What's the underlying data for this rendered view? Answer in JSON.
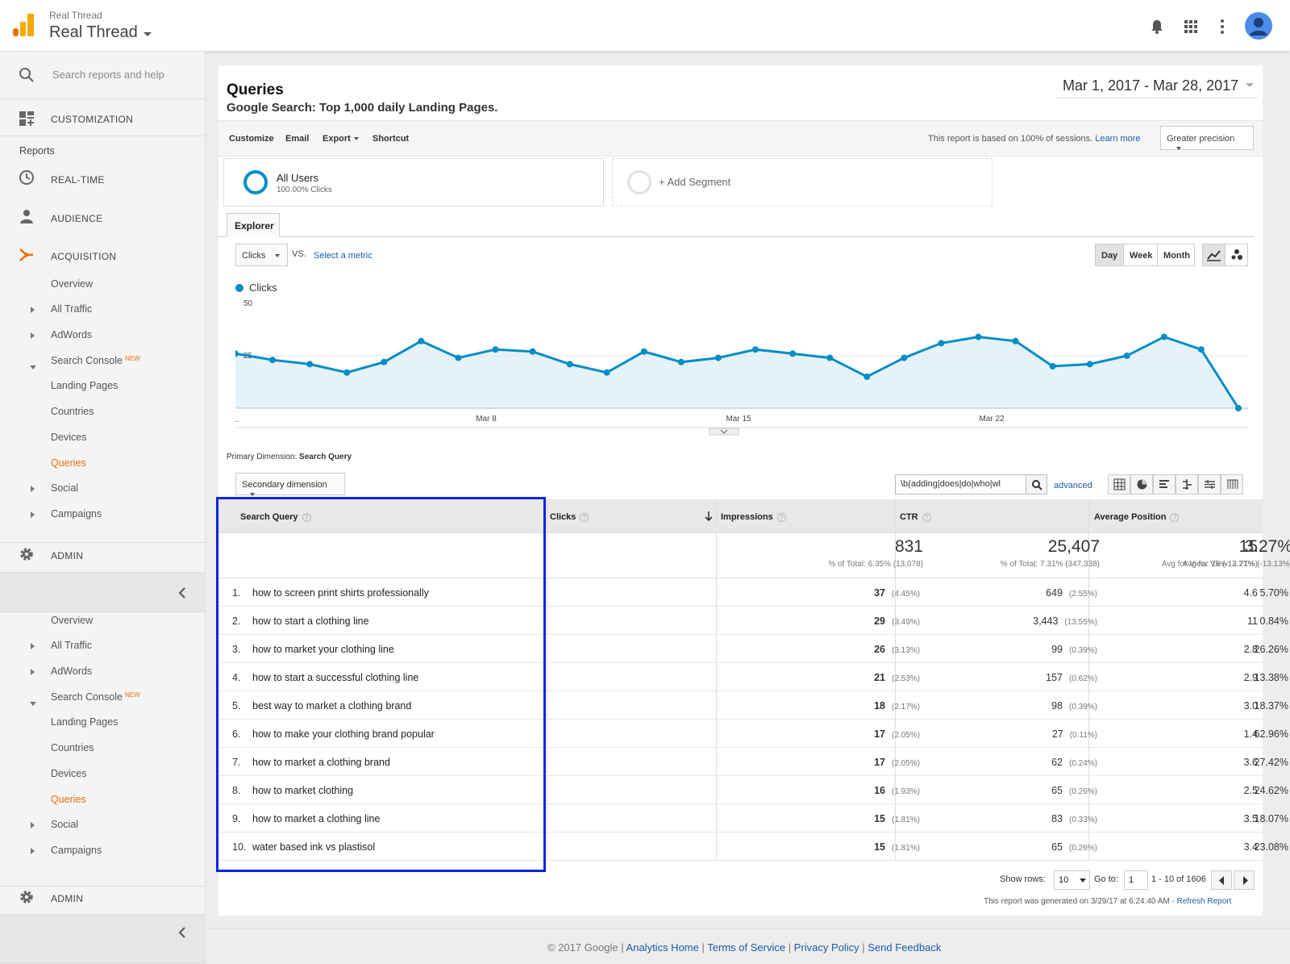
{
  "header": {
    "account_small": "Real Thread",
    "account_name": "Real Thread"
  },
  "sidebar": {
    "search_placeholder": "Search reports and help",
    "customization": "CUSTOMIZATION",
    "reports_label": "Reports",
    "realtime": "REAL-TIME",
    "audience": "AUDIENCE",
    "acquisition": "ACQUISITION",
    "admin": "ADMIN",
    "new_badge": "NEW",
    "items": [
      "Overview",
      "All Traffic",
      "AdWords",
      "Search Console",
      "Landing Pages",
      "Countries",
      "Devices",
      "Queries",
      "Social",
      "Campaigns"
    ]
  },
  "report": {
    "title": "Queries",
    "subtitle": "Google Search: Top 1,000 daily Landing Pages.",
    "date_range": "Mar 1, 2017 - Mar 28, 2017"
  },
  "toolbar": {
    "customize": "Customize",
    "email": "Email",
    "export": "Export",
    "shortcut": "Shortcut",
    "sampling": "This report is based on 100% of sessions.",
    "learn_more": "Learn more",
    "precision": "Greater precision"
  },
  "segments": {
    "name": "All Users",
    "sub": "100.00% Clicks",
    "add": "+ Add Segment"
  },
  "explorer": {
    "tab": "Explorer",
    "metric": "Clicks",
    "vs": "VS.",
    "select_metric": "Select a metric",
    "day": "Day",
    "week": "Week",
    "month": "Month"
  },
  "chart_data": {
    "type": "line",
    "title": "",
    "series": [
      {
        "name": "Clicks",
        "values": [
          26,
          23,
          21,
          17,
          22,
          32,
          24,
          28,
          27,
          21,
          17,
          27,
          22,
          24,
          28,
          26,
          24,
          15,
          24,
          31,
          34,
          32,
          20,
          21,
          25,
          34,
          28,
          0
        ]
      }
    ],
    "x_ticks": [
      "...",
      "Mar 8",
      "Mar 15",
      "Mar 22"
    ],
    "y_ticks": [
      "50",
      "25"
    ],
    "ylim": [
      0,
      50
    ],
    "color": "#058dc7",
    "grid": true
  },
  "dimensions": {
    "primary_label": "Primary Dimension:",
    "primary_value": "Search Query",
    "secondary": "Secondary dimension",
    "filter_value": "\\b(adding|does|do|who|wl",
    "advanced": "advanced"
  },
  "table": {
    "headers": {
      "query": "Search Query",
      "clicks": "Clicks",
      "impressions": "Impressions",
      "ctr": "CTR",
      "position": "Average Position"
    },
    "totals": {
      "clicks": "831",
      "clicks_sub": "% of Total: 6.35% (13,078)",
      "impressions": "25,407",
      "impressions_sub": "% of Total: 7.31% (347,338)",
      "ctr": "3.27%",
      "ctr_sub": "Avg for View: 3.77% (-13.13%)",
      "position": "15",
      "position_sub": "Avg for View: 18 (-12.21%)"
    },
    "rows": [
      {
        "idx": "1.",
        "query": "how to screen print shirts professionally",
        "clicks": "37",
        "clicks_pct": "(4.45%)",
        "impr": "649",
        "impr_pct": "(2.55%)",
        "ctr": "5.70%",
        "pos": "4.6"
      },
      {
        "idx": "2.",
        "query": "how to start a clothing line",
        "clicks": "29",
        "clicks_pct": "(3.49%)",
        "impr": "3,443",
        "impr_pct": "(13.55%)",
        "ctr": "0.84%",
        "pos": "11"
      },
      {
        "idx": "3.",
        "query": "how to market your clothing line",
        "clicks": "26",
        "clicks_pct": "(3.13%)",
        "impr": "99",
        "impr_pct": "(0.39%)",
        "ctr": "26.26%",
        "pos": "2.8"
      },
      {
        "idx": "4.",
        "query": "how to start a successful clothing line",
        "clicks": "21",
        "clicks_pct": "(2.53%)",
        "impr": "157",
        "impr_pct": "(0.62%)",
        "ctr": "13.38%",
        "pos": "2.9"
      },
      {
        "idx": "5.",
        "query": "best way to market a clothing brand",
        "clicks": "18",
        "clicks_pct": "(2.17%)",
        "impr": "98",
        "impr_pct": "(0.39%)",
        "ctr": "18.37%",
        "pos": "3.0"
      },
      {
        "idx": "6.",
        "query": "how to make your clothing brand popular",
        "clicks": "17",
        "clicks_pct": "(2.05%)",
        "impr": "27",
        "impr_pct": "(0.11%)",
        "ctr": "62.96%",
        "pos": "1.4"
      },
      {
        "idx": "7.",
        "query": "how to market a clothing brand",
        "clicks": "17",
        "clicks_pct": "(2.05%)",
        "impr": "62",
        "impr_pct": "(0.24%)",
        "ctr": "27.42%",
        "pos": "3.6"
      },
      {
        "idx": "8.",
        "query": "how to market clothing",
        "clicks": "16",
        "clicks_pct": "(1.93%)",
        "impr": "65",
        "impr_pct": "(0.26%)",
        "ctr": "24.62%",
        "pos": "2.5"
      },
      {
        "idx": "9.",
        "query": "how to market a clothing line",
        "clicks": "15",
        "clicks_pct": "(1.81%)",
        "impr": "83",
        "impr_pct": "(0.33%)",
        "ctr": "18.07%",
        "pos": "3.5"
      },
      {
        "idx": "10.",
        "query": "water based ink vs plastisol",
        "clicks": "15",
        "clicks_pct": "(1.81%)",
        "impr": "65",
        "impr_pct": "(0.26%)",
        "ctr": "23.08%",
        "pos": "3.4"
      }
    ]
  },
  "pagination": {
    "show_rows": "Show rows:",
    "rows_value": "10",
    "goto": "Go to:",
    "goto_value": "1",
    "range": "1 - 10 of 1606",
    "generated": "This report was generated on 3/29/17 at 6:24:40 AM -",
    "refresh": "Refresh Report"
  },
  "footer": {
    "copyright": "© 2017 Google |",
    "analytics_home": "Analytics Home",
    "terms": "Terms of Service",
    "privacy": "Privacy Policy",
    "feedback": "Send Feedback",
    "sep": "|"
  }
}
